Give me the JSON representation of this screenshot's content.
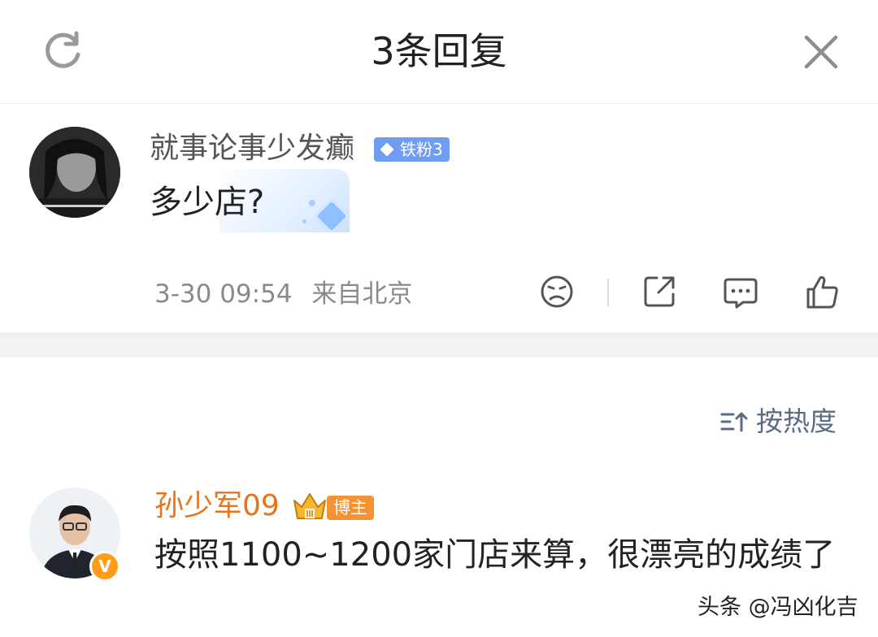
{
  "header": {
    "title": "3条回复",
    "refresh_icon": "refresh-icon",
    "close_icon": "close-icon"
  },
  "root_comment": {
    "username": "就事论事少发癫",
    "fan_badge": "铁粉3",
    "text": "多少店?",
    "timestamp": "3-30 09:54",
    "location": "来自北京",
    "actions": [
      "dislike-icon",
      "share-icon",
      "comment-icon",
      "like-icon"
    ]
  },
  "sort": {
    "label": "按热度",
    "icon": "sort-icon"
  },
  "reply": {
    "username": "孙少军09",
    "role_badge": "博主",
    "verified_mark": "V",
    "text": "按照1100~1200家门店来算，很漂亮的成绩了"
  },
  "watermark": "头条 @冯凶化吉",
  "colors": {
    "badge_blue": "#6f9df0",
    "reply_name_orange": "#e8731a",
    "role_badge_orange": "#f59332",
    "sort_text": "#5a6b85"
  }
}
